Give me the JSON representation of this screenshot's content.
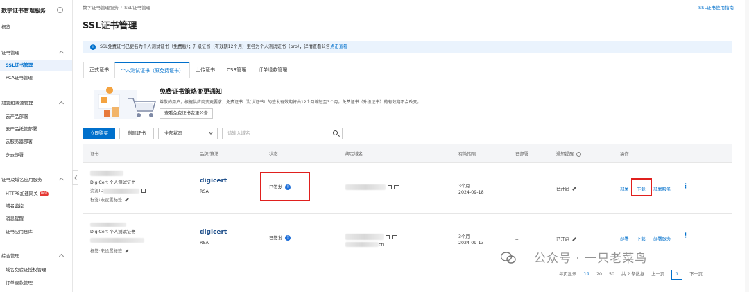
{
  "sidebar": {
    "title": "数字证书管理服务",
    "overview": "概览",
    "groups": [
      {
        "label": "证书管理",
        "items": [
          "SSL证书管理",
          "PCA证书管理"
        ]
      },
      {
        "label": "部署和资源管理",
        "items": [
          "云产品部署",
          "云产品托管部署",
          "云服务器部署",
          "多云部署"
        ]
      },
      {
        "label": "证书及域名应用服务",
        "items": [
          "HTTPS加速网关",
          "域名监控",
          "消息提醒",
          "证书应用仓库"
        ]
      },
      {
        "label": "综合管理",
        "items": [
          "域名免验证授权管理",
          "订单退款管理"
        ]
      }
    ],
    "hot_badge": "HOT"
  },
  "breadcrumb": {
    "root": "数字证书管理服务",
    "sep": "/",
    "current": "SSL证书管理"
  },
  "help_link": "SSL证书使用指南",
  "page_title": "SSL证书管理",
  "notice": {
    "text": "SSL免费证书已更名为个人测试证书（免费版）；升级证书（有效期12个月）更名为个人测试证书（pro），详情查看公告",
    "link": "点击查看"
  },
  "tabs": [
    "正式证书",
    "个人测试证书（原免费证书）",
    "上传证书",
    "CSR管理",
    "订单退款管理"
  ],
  "promo": {
    "title": "免费证书策略变更通知",
    "text": "尊敬的用户，根据供应商变更要求，免费证书（默认证书）的签发有效期将由12个月缩短至3个月。免费证书（升级证书）的有效期不会改变。",
    "button": "查看免费证书变更公告"
  },
  "toolbar": {
    "buy": "立即购买",
    "create": "创建证书",
    "filter": "全部状态",
    "search_placeholder": "请输入域名"
  },
  "table": {
    "headers": [
      "证书",
      "品牌/算法",
      "状态",
      "绑定域名",
      "有效期限",
      "已部署",
      "通知提醒",
      "操作"
    ],
    "rows": [
      {
        "cert_name": "DigiCert 个人测试证书",
        "resource_prefix": "资源ID",
        "tag": "标签:未设置标签",
        "brand": "digicert",
        "algo": "RSA",
        "status": "已签发",
        "domain_suffix": "",
        "validity": "3个月",
        "date": "2024-09-18",
        "deployed": "--",
        "notify": "已开启",
        "actions": [
          "部署",
          "下载",
          "部署服务"
        ]
      },
      {
        "cert_name": "DigiCert 个人测试证书",
        "resource_prefix": "",
        "tag": "标签:未设置标签",
        "brand": "digicert",
        "algo": "RSA",
        "status": "已签发",
        "domain_suffix": "cn",
        "validity": "3个月",
        "date": "2024-09-13",
        "deployed": "--",
        "notify": "已开启",
        "actions": [
          "部署",
          "下载",
          "部署服务"
        ]
      }
    ]
  },
  "pagination": {
    "label": "每页显示",
    "sizes": [
      "10",
      "20",
      "50"
    ],
    "total": "共 2 条数据",
    "prev": "上一页",
    "page": "1",
    "next": "下一页"
  },
  "watermark": "公众号 · 一只老菜鸟"
}
